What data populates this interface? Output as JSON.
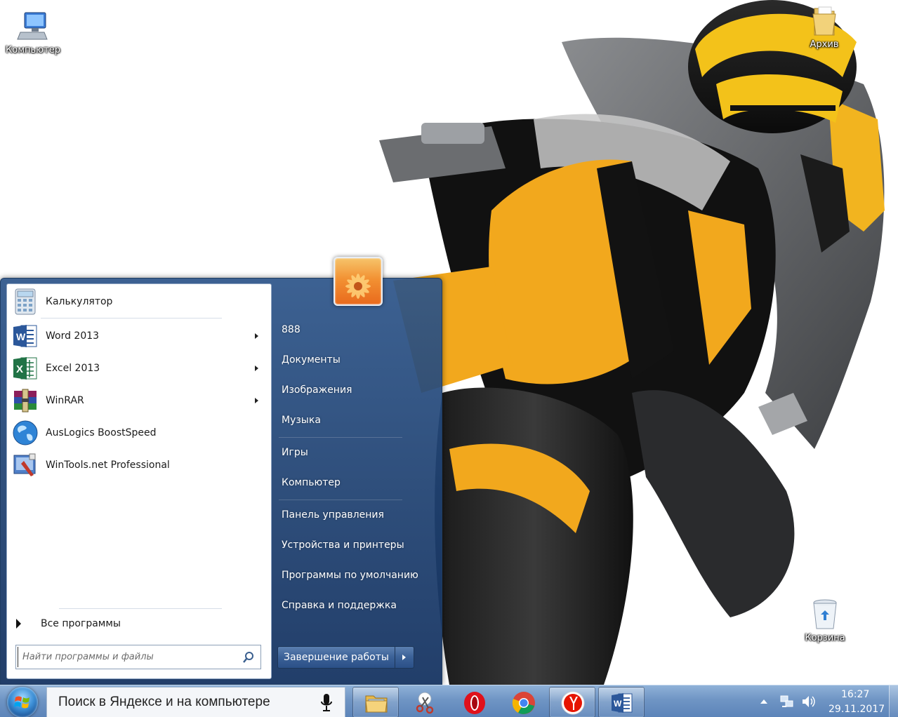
{
  "desktop": {
    "icons": [
      {
        "label": "Компьютер"
      },
      {
        "label": "Архив"
      },
      {
        "label": "Корзина"
      }
    ]
  },
  "start_menu": {
    "pinned_programs": [
      {
        "label": "Калькулятор",
        "icon": "calculator-icon",
        "has_submenu": false
      },
      {
        "label": "Word 2013",
        "icon": "word-icon",
        "has_submenu": true
      },
      {
        "label": "Excel 2013",
        "icon": "excel-icon",
        "has_submenu": true
      },
      {
        "label": "WinRAR",
        "icon": "winrar-icon",
        "has_submenu": true
      },
      {
        "label": "AusLogics BoostSpeed",
        "icon": "globe-icon",
        "has_submenu": false
      },
      {
        "label": "WinTools.net Professional",
        "icon": "wintools-icon",
        "has_submenu": false
      }
    ],
    "all_programs_label": "Все программы",
    "search_placeholder": "Найти программы и файлы",
    "right_links": [
      {
        "label": "888"
      },
      {
        "label": "Документы"
      },
      {
        "label": "Изображения"
      },
      {
        "label": "Музыка"
      },
      {
        "label": "Игры"
      },
      {
        "label": "Компьютер"
      },
      {
        "label": "Панель управления"
      },
      {
        "label": "Устройства и принтеры"
      },
      {
        "label": "Программы по умолчанию"
      },
      {
        "label": "Справка и поддержка"
      }
    ],
    "shutdown_label": "Завершение работы"
  },
  "taskbar": {
    "search_text": "Поиск в Яндексе и на компьютере",
    "pinned": [
      {
        "icon": "file-explorer-icon"
      },
      {
        "icon": "scissors-tool-icon"
      },
      {
        "icon": "opera-icon"
      },
      {
        "icon": "chrome-icon"
      },
      {
        "icon": "yandex-browser-icon"
      },
      {
        "icon": "word-icon"
      }
    ],
    "clock": {
      "time": "16:27",
      "date": "29.11.2017"
    }
  },
  "colors": {
    "accent_yellow": "#f2a81d",
    "menu_blue": "#2c5489",
    "taskbar_blue": "#6f95c4"
  }
}
